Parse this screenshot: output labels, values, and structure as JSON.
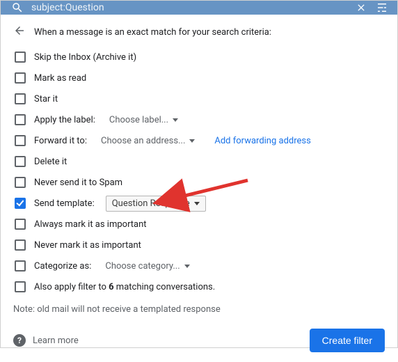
{
  "topbar": {
    "query": "subject:Question"
  },
  "heading": "When a message is an exact match for your search criteria:",
  "options": {
    "skip_inbox": "Skip the Inbox (Archive it)",
    "mark_read": "Mark as read",
    "star": "Star it",
    "apply_label": "Apply the label:",
    "apply_label_choice": "Choose label...",
    "forward": "Forward it to:",
    "forward_choice": "Choose an address...",
    "add_forwarding": "Add forwarding address",
    "delete": "Delete it",
    "never_spam": "Never send it to Spam",
    "send_template": "Send template:",
    "send_template_choice": "Question Response",
    "always_important": "Always mark it as important",
    "never_important": "Never mark it as important",
    "categorize": "Categorize as:",
    "categorize_choice": "Choose category...",
    "also_apply_pre": "Also apply filter to ",
    "also_apply_count": "6",
    "also_apply_post": " matching conversations."
  },
  "note": "Note: old mail will not receive a templated response",
  "footer": {
    "learn_more": "Learn more",
    "create_filter": "Create filter"
  }
}
